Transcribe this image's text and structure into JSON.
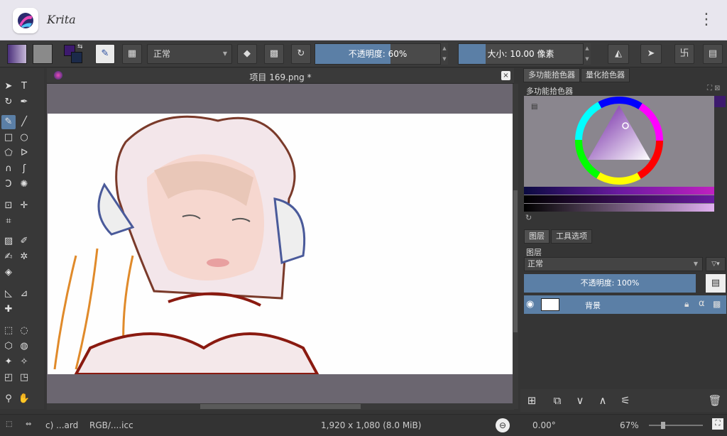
{
  "app": {
    "title": "Krita",
    "menu_icon": "more-vert-icon"
  },
  "toolbar": {
    "blend_mode": "正常",
    "opacity": "不透明度: 60%",
    "opacity_value": 0.6,
    "size": "大小: 10.00 像素",
    "fg_color": "#3d1a6e",
    "bg_color": "#1b2a4a"
  },
  "document": {
    "title": "项目 169.png *",
    "close": "×"
  },
  "panels": {
    "tab_advanced": "多功能拾色器",
    "tab_specific": "量化拾色器",
    "selector_title": "多功能拾色器",
    "tab_layers": "图层",
    "tab_tool_options": "工具选项",
    "layers_title": "图层",
    "layer_blend": "正常",
    "layer_opacity": "不透明度: 100%",
    "layer_name": "背景"
  },
  "status": {
    "profile": "c) ...ard",
    "colorspace": "RGB/....icc",
    "dimensions": "1,920 x 1,080 (8.0 MiB)",
    "rotation": "0.00°",
    "zoom": "67%"
  }
}
